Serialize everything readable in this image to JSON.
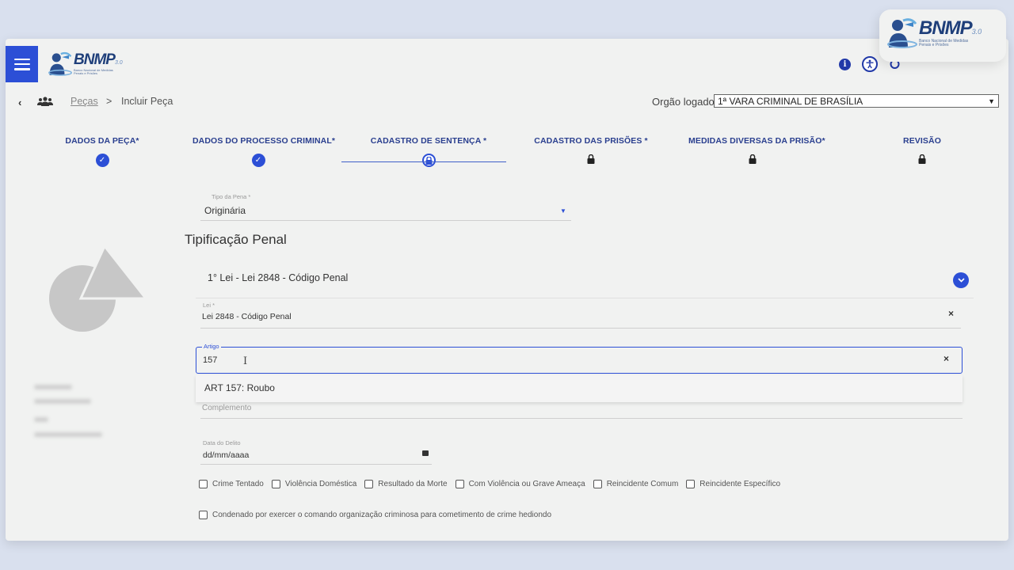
{
  "corner_logo": {
    "name": "BNMP",
    "version": "3.0",
    "subtitle": [
      "Banco Nacional de Medidas",
      "Penais e Prisões"
    ]
  },
  "header": {
    "menu_icon": "hamburger-icon",
    "logo": {
      "name": "BNMP",
      "version": "3.0",
      "subtitle": [
        "Banco Nacional de Medidas",
        "Penais e Prisões"
      ]
    },
    "icons": [
      "info-icon",
      "accessibility-icon",
      "user-settings-icon"
    ]
  },
  "breadcrumb": {
    "back_icon": "chevron-left-icon",
    "group_icon": "people-icon",
    "link": "Peças",
    "separator": ">",
    "current": "Incluir Peça"
  },
  "orgao": {
    "label": "Orgão logado:",
    "value": "1ª VARA CRIMINAL DE BRASÍLIA"
  },
  "steps": [
    {
      "label": "DADOS DA PEÇA*",
      "status": "done"
    },
    {
      "label": "DADOS DO PROCESSO CRIMINAL*",
      "status": "done"
    },
    {
      "label": "CADASTRO DE SENTENÇA *",
      "status": "current"
    },
    {
      "label": "CADASTRO DAS PRISÕES *",
      "status": "locked"
    },
    {
      "label": "MEDIDAS DIVERSAS DA PRISÃO*",
      "status": "locked"
    },
    {
      "label": "REVISÃO",
      "status": "locked"
    }
  ],
  "form": {
    "tipo_pena": {
      "label": "Tipo da Pena *",
      "value": "Originária"
    },
    "section_title": "Tipificação Penal",
    "law_item": {
      "title": "1° Lei - Lei 2848 - Código Penal"
    },
    "lei": {
      "label": "Lei *",
      "value": "Lei 2848 - Código Penal"
    },
    "artigo": {
      "label": "Artigo",
      "value": "157"
    },
    "artigo_suggestion": "ART 157: Roubo",
    "complemento": {
      "placeholder": "Complemento"
    },
    "data_delito": {
      "label": "Data do Delito",
      "value": "dd/mm/aaaa"
    },
    "checkboxes": [
      "Crime Tentado",
      "Violência Doméstica",
      "Resultado da Morte",
      "Com Violência ou Grave Ameaça",
      "Reincidente Comum",
      "Reincidente Específico"
    ],
    "checkbox_long": "Condenado por exercer o comando organização criminosa para cometimento de crime hediondo"
  },
  "colors": {
    "primary": "#2c4fd6",
    "logo_dark": "#1f3f7a",
    "background": "#f1f2f1"
  }
}
